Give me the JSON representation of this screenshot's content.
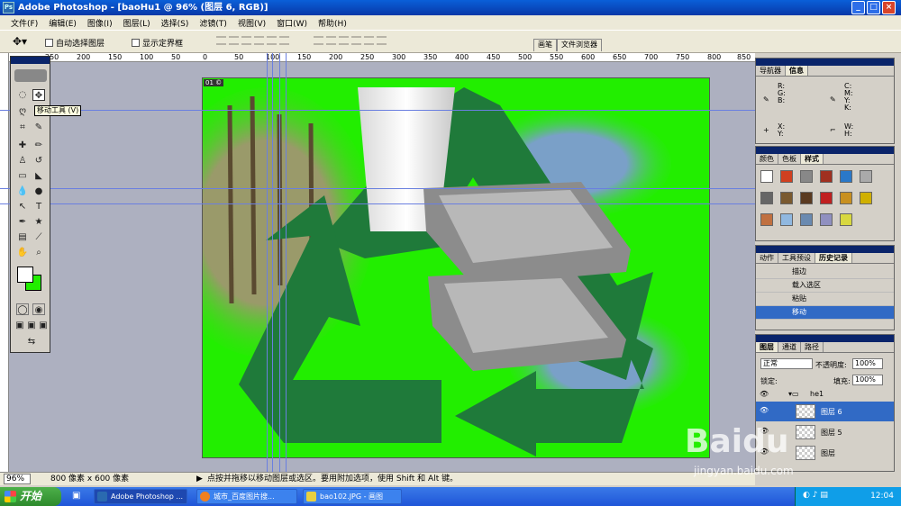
{
  "window": {
    "title": "Adobe Photoshop - [baoHu1 @ 96% (图层 6, RGB)]",
    "min_label": "_",
    "max_label": "□",
    "close_label": "×"
  },
  "menu": [
    "文件(F)",
    "编辑(E)",
    "图像(I)",
    "图层(L)",
    "选择(S)",
    "滤镜(T)",
    "视图(V)",
    "窗口(W)",
    "帮助(H)"
  ],
  "options": {
    "auto_select_layer": "自动选择图层",
    "show_bounding_box": "显示定界框",
    "tab_brushes": "画笔",
    "tab_file_browser": "文件浏览器"
  },
  "ruler_ticks": [
    "250",
    "200",
    "150",
    "100",
    "50",
    "0",
    "50",
    "100",
    "150",
    "200",
    "250",
    "300",
    "350",
    "400",
    "450",
    "500",
    "550",
    "600",
    "650",
    "700",
    "750",
    "800",
    "850"
  ],
  "tooltip": "移动工具 (V)",
  "document": {
    "tag": "01 ©"
  },
  "panels": {
    "navigator": {
      "tabs": [
        "导航器",
        "信息"
      ]
    },
    "info": {
      "rgb": "R:\nG:\nB:",
      "cmyk": "C:\nM:\nY:\nK:",
      "xy": "X:\nY:",
      "wh": "W:\nH:"
    },
    "color": {
      "tabs": [
        "颜色",
        "色板",
        "样式"
      ]
    },
    "history": {
      "tabs": [
        "动作",
        "工具预设",
        "历史记录"
      ],
      "items": [
        "描边",
        "载入选区",
        "粘贴",
        "移动"
      ]
    },
    "layers": {
      "tabs": [
        "图层",
        "通道",
        "路径"
      ],
      "blend_mode": "正常",
      "opacity_label": "不透明度:",
      "opacity_value": "100%",
      "lock_label": "锁定:",
      "fill_label": "填充:",
      "fill_value": "100%",
      "group_name": "he1",
      "layer_names": [
        "图层 6",
        "图层 5",
        "图层"
      ]
    }
  },
  "status": {
    "zoom": "96%",
    "doc_size": "800 像素 x 600 像素",
    "hint": "点按并拖移以移动图层或选区。要用附加选项，使用 Shift 和 Alt 键。"
  },
  "taskbar": {
    "start": "开始",
    "tasks": [
      "Adobe Photoshop ...",
      "城市_百度图片搜...",
      "bao102.JPG - 画图"
    ],
    "clock": "12:04"
  },
  "watermark": {
    "brand": "Baidu",
    "sub": "jingyan.baidu.com"
  },
  "colors": {
    "canvas_green": "#22ee00",
    "arrow_green": "#1f7a3a",
    "titlebar": "#0a5fd8"
  }
}
